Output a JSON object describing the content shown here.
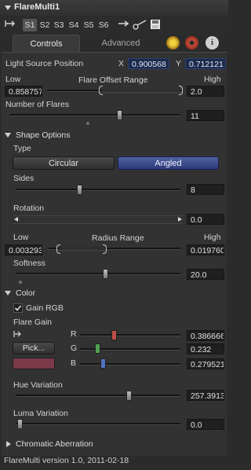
{
  "title_bar": {
    "title": "FlareMulti1"
  },
  "view_buttons": [
    {
      "label": "S1",
      "selected": true
    },
    {
      "label": "S2",
      "selected": false
    },
    {
      "label": "S3",
      "selected": false
    },
    {
      "label": "S4",
      "selected": false
    },
    {
      "label": "S5",
      "selected": false
    },
    {
      "label": "S6",
      "selected": false
    }
  ],
  "tabs": {
    "controls": "Controls",
    "advanced": "Advanced"
  },
  "light_source_position": {
    "label": "Light Source Position",
    "x_label": "X",
    "x_value": "0.900568",
    "y_label": "Y",
    "y_value": "0.712121"
  },
  "flare_offset_range": {
    "title": "Flare Offset Range",
    "low_label": "Low",
    "high_label": "High",
    "low_value": "0.858757",
    "high_value": "2.0"
  },
  "number_of_flares": {
    "label": "Number of Flares",
    "value": "11"
  },
  "shape_options": {
    "section_label": "Shape Options",
    "type_label": "Type",
    "type_options": [
      "Circular",
      "Angled"
    ],
    "type_selected": "Angled",
    "sides": {
      "label": "Sides",
      "value": "8"
    },
    "rotation": {
      "label": "Rotation",
      "value": "0.0"
    },
    "radius_range": {
      "title": "Radius Range",
      "low_label": "Low",
      "high_label": "High",
      "low_value": "0.003293",
      "high_value": "0.019760"
    },
    "softness": {
      "label": "Softness",
      "value": "20.0"
    }
  },
  "color": {
    "section_label": "Color",
    "gain_rgb": {
      "label": "Gain RGB",
      "checked": true
    },
    "flare_gain_label": "Flare Gain",
    "pick_label": "Pick...",
    "swatch_color": "#7a3a4a",
    "r": {
      "label": "R",
      "value": "0.386666",
      "knob_color": "#c0504a"
    },
    "g": {
      "label": "G",
      "value": "0.232",
      "knob_color": "#50a050"
    },
    "b": {
      "label": "B",
      "value": "0.279521",
      "knob_color": "#5070c0"
    },
    "hue_variation": {
      "label": "Hue Variation",
      "value": "257.3913"
    },
    "luma_variation": {
      "label": "Luma Variation",
      "value": "0.0"
    }
  },
  "chromatic_aberration": {
    "section_label": "Chromatic Aberration"
  },
  "footer": {
    "version_text": "FlareMulti version 1.0, 2011-02-18"
  }
}
